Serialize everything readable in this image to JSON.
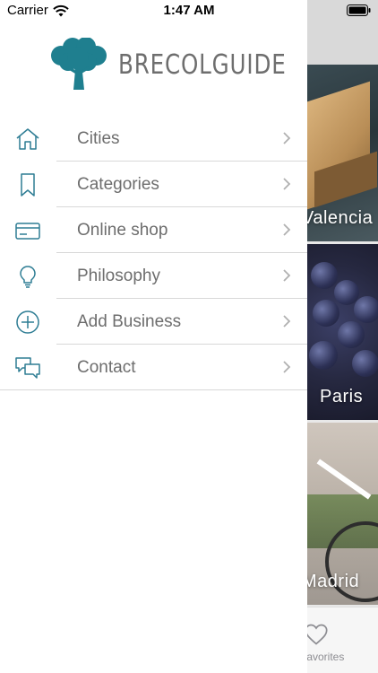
{
  "status_bar": {
    "carrier": "Carrier",
    "time": "1:47 AM"
  },
  "brand": {
    "name": "BRECOLGUIDE",
    "logo_color": "#1f7f8f"
  },
  "menu": {
    "items": [
      {
        "label": "Cities",
        "icon": "home-icon"
      },
      {
        "label": "Categories",
        "icon": "bookmark-icon"
      },
      {
        "label": "Online shop",
        "icon": "credit-card-icon"
      },
      {
        "label": "Philosophy",
        "icon": "lightbulb-icon"
      },
      {
        "label": "Add Business",
        "icon": "plus-circle-icon"
      },
      {
        "label": "Contact",
        "icon": "chat-bubbles-icon"
      }
    ]
  },
  "background": {
    "cities": [
      "Valencia",
      "Paris",
      "Madrid"
    ],
    "tab_label": "Favorites"
  },
  "colors": {
    "icon": "#2e7d94",
    "text": "#6d6d6d",
    "divider": "#d8d8d8"
  }
}
